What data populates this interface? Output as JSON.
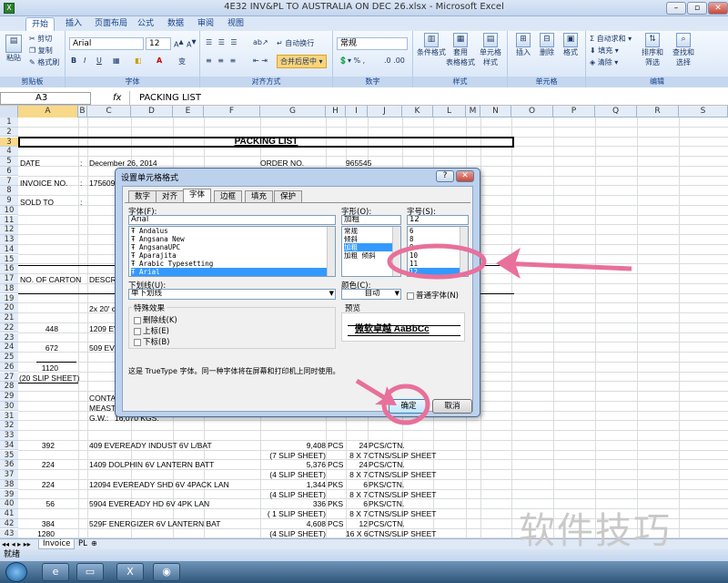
{
  "window": {
    "title": "4E32 INV&PL TO AUSTRALIA ON DEC 26.xlsx - Microsoft Excel"
  },
  "ribbon_tabs": [
    "开始",
    "插入",
    "页面布局",
    "公式",
    "数据",
    "审阅",
    "视图"
  ],
  "ribbon": {
    "clipboard": {
      "paste": "粘贴",
      "cut": "剪切",
      "copy": "复制",
      "painter": "格式刷",
      "label": "剪贴板"
    },
    "font": {
      "name": "Arial",
      "size": "12",
      "label": "字体"
    },
    "align": {
      "wrap": "自动换行",
      "merge": "合并后居中",
      "label": "对齐方式"
    },
    "number": {
      "format": "常规",
      "label": "数字"
    },
    "styles": {
      "cond": "条件格式",
      "table": "套用\n表格格式",
      "cell": "单元格\n样式",
      "label": "样式"
    },
    "cells": {
      "insert": "插入",
      "delete": "删除",
      "format": "格式",
      "label": "单元格"
    },
    "editing": {
      "sum": "自动求和",
      "fill": "填充",
      "clear": "清除",
      "sort": "排序和\n筛选",
      "find": "查找和\n选择",
      "label": "编辑"
    }
  },
  "formula_bar": {
    "cell": "A3",
    "fx": "fx",
    "content": "PACKING LIST"
  },
  "columns": [
    "A",
    "B",
    "C",
    "D",
    "E",
    "F",
    "G",
    "H",
    "I",
    "J",
    "K",
    "L",
    "M",
    "N",
    "O",
    "P",
    "Q",
    "R",
    "S"
  ],
  "rows": [
    "1",
    "2",
    "3",
    "4",
    "5",
    "6",
    "7",
    "8",
    "9",
    "10",
    "11",
    "12",
    "13",
    "14",
    "15",
    "16",
    "17",
    "18",
    "19",
    "20",
    "21",
    "22",
    "23",
    "24",
    "25",
    "26",
    "27",
    "28",
    "29",
    "30",
    "31",
    "32",
    "33",
    "34",
    "35",
    "36",
    "37",
    "38",
    "39",
    "40",
    "41",
    "42",
    "43"
  ],
  "sheet": {
    "title": "PACKING LIST",
    "date_label": "DATE",
    "colon": ":",
    "date": "December 26, 2014",
    "order_label": "ORDER NO.",
    "order_no": "965545",
    "invoice_label": "INVOICE NO.",
    "invoice_no": "175609",
    "sold_label": "SOLD TO",
    "cartons_hdr": "NO. OF CARTON",
    "desc_hdr": "DESCR",
    "r20": "2x 20' c",
    "r22a": "448",
    "r22c": "1209 EV",
    "r24a": "672",
    "r24c": "509 EVI",
    "r26": "1120",
    "r27": "(20 SLIP SHEET)",
    "r29": "CONTA",
    "r30": "MEAST",
    "r31": "G.W.:",
    "r31b": "16,070 KGS.",
    "lines": [
      {
        "a": "392",
        "c": "409 EVEREADY INDUST 6V L/BAT",
        "g": "9,408",
        "h": "PCS",
        "i": "24",
        "j": "PCS/CTN."
      },
      {
        "a": "",
        "c": "",
        "g": "(7 SLIP SHEET)",
        "h": "",
        "i": "8 X 7",
        "j": "CTNS/SLIP SHEET"
      },
      {
        "a": "224",
        "c": "1409  DOLPHIN 6V LANTERN BATT",
        "g": "5,376",
        "h": "PCS",
        "i": "24",
        "j": "PCS/CTN."
      },
      {
        "a": "",
        "c": "",
        "g": "(4 SLIP SHEET)",
        "h": "",
        "i": "8 X 7",
        "j": "CTNS/SLIP SHEET"
      },
      {
        "a": "224",
        "c": "12094 EVEREADY SHD 6V 4PACK LAN",
        "g": "1,344",
        "h": "PKS",
        "i": "6",
        "j": "PKS/CTN."
      },
      {
        "a": "",
        "c": "",
        "g": "(4 SLIP SHEET)",
        "h": "",
        "i": "8 X 7",
        "j": "CTNS/SLIP SHEET"
      },
      {
        "a": "56",
        "c": "5904 EVEREADY HD 6V 4PK LAN",
        "g": "336",
        "h": "PKS",
        "i": "6",
        "j": "PKS/CTN."
      },
      {
        "a": "",
        "c": "",
        "g": "( 1 SLIP SHEET)",
        "h": "",
        "i": "8 X 7",
        "j": "CTNS/SLIP SHEET"
      },
      {
        "a": "384",
        "c": "529F ENERGIZER 6V LANTERN BAT",
        "g": "4,608",
        "h": "PCS",
        "i": "12",
        "j": "PCS/CTN."
      },
      {
        "a": "1280",
        "c": "",
        "g": "(4 SLIP SHEET)",
        "h": "",
        "i": "16 X 6",
        "j": "CTNS/SLIP SHEET"
      }
    ]
  },
  "sheet_tabs": [
    "Invoice",
    "PL"
  ],
  "status": "就绪",
  "dialog": {
    "title": "设置单元格格式",
    "tabs": [
      "数字",
      "对齐",
      "字体",
      "边框",
      "填充",
      "保护"
    ],
    "font_label": "字体(F):",
    "font_value": "Arial",
    "font_list": [
      "Andalus",
      "Angsana New",
      "AngsanaUPC",
      "Aparajita",
      "Arabic Typesetting",
      "Arial"
    ],
    "style_label": "字形(O):",
    "style_value": "加粗",
    "style_list": [
      "常规",
      "倾斜",
      "加粗",
      "加粗 倾斜"
    ],
    "size_label": "字号(S):",
    "size_value": "12",
    "size_list": [
      "6",
      "8",
      "9",
      "10",
      "11",
      "12"
    ],
    "underline_label": "下划线(U):",
    "underline_value": "单下划线",
    "color_label": "颜色(C):",
    "color_value": "自动",
    "normal_font": "普通字体(N)",
    "effects_label": "特殊效果",
    "strike": "删除线(K)",
    "superscript": "上标(E)",
    "subscript": "下标(B)",
    "preview_label": "预览",
    "preview_text": "微软卓越  AaBbCc",
    "note": "这是 TrueType 字体。同一种字体将在屏幕和打印机上同时使用。",
    "ok": "确定",
    "cancel": "取消"
  },
  "watermark": "软件技巧",
  "colors": {
    "annotation": "#e8709a",
    "selection": "#3399ff"
  }
}
